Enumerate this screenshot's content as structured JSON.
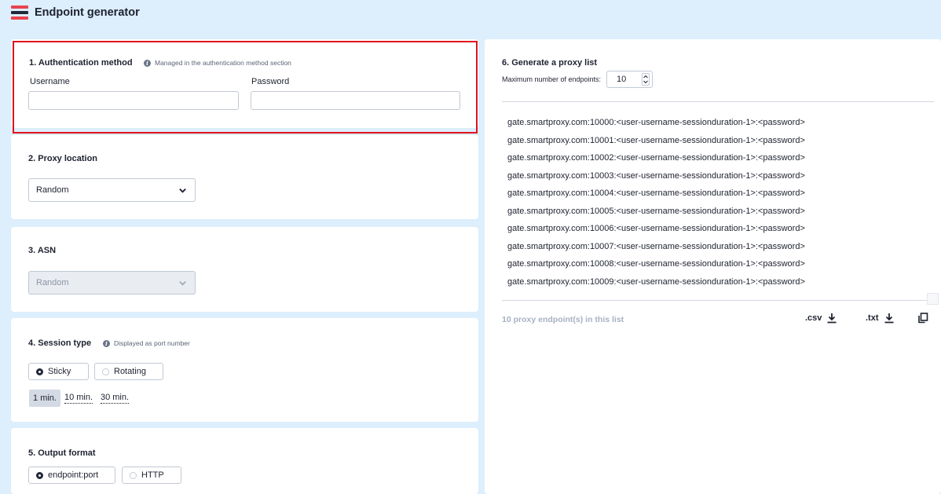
{
  "header": {
    "title": "Endpoint generator"
  },
  "auth": {
    "title": "1. Authentication method",
    "hint": "Managed in the authentication method section",
    "username_label": "Username",
    "password_label": "Password",
    "username_value": "",
    "password_value": ""
  },
  "location": {
    "title": "2. Proxy location",
    "selected": "Random"
  },
  "asn": {
    "title": "3. ASN",
    "selected": "Random"
  },
  "session": {
    "title": "4. Session type",
    "hint": "Displayed as port number",
    "options": [
      "Sticky",
      "Rotating"
    ],
    "selected": "Sticky",
    "durations": [
      "1 min.",
      "10 min.",
      "30 min."
    ],
    "selected_duration": "1 min."
  },
  "output": {
    "title": "5. Output format",
    "options": [
      "endpoint:port",
      "HTTP"
    ],
    "selected": "endpoint:port"
  },
  "proxy_list": {
    "title": "6. Generate a proxy list",
    "max_label": "Maximum number of endpoints:",
    "max_value": "10",
    "endpoints": [
      "gate.smartproxy.com:10000:<user-username-sessionduration-1>:<password>",
      "gate.smartproxy.com:10001:<user-username-sessionduration-1>:<password>",
      "gate.smartproxy.com:10002:<user-username-sessionduration-1>:<password>",
      "gate.smartproxy.com:10003:<user-username-sessionduration-1>:<password>",
      "gate.smartproxy.com:10004:<user-username-sessionduration-1>:<password>",
      "gate.smartproxy.com:10005:<user-username-sessionduration-1>:<password>",
      "gate.smartproxy.com:10006:<user-username-sessionduration-1>:<password>",
      "gate.smartproxy.com:10007:<user-username-sessionduration-1>:<password>",
      "gate.smartproxy.com:10008:<user-username-sessionduration-1>:<password>",
      "gate.smartproxy.com:10009:<user-username-sessionduration-1>:<password>"
    ],
    "count_text": "10 proxy endpoint(s) in this list",
    "csv_label": ".csv",
    "txt_label": ".txt"
  },
  "icons": {
    "logo": "brand-logo-icon",
    "info": "info-icon",
    "chevron": "chevron-down-icon",
    "download": "download-icon",
    "copy": "copy-icon"
  },
  "colors": {
    "background": "#ddeefc",
    "highlight": "#e0141e",
    "brand_red": "#e9424f",
    "brand_dark": "#23273a"
  }
}
